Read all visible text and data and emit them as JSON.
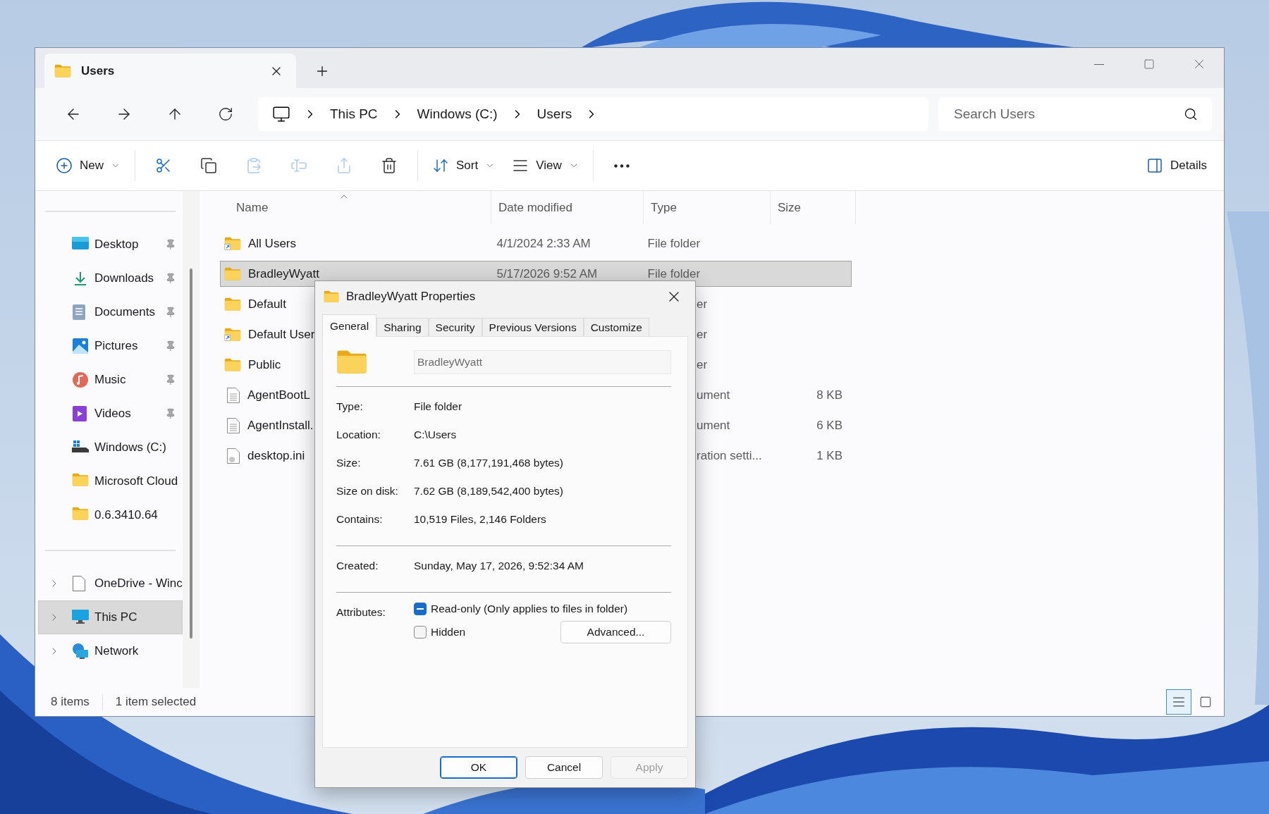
{
  "window": {
    "tab": {
      "title": "Users"
    }
  },
  "address": {
    "crumbs": [
      "This PC",
      "Windows (C:)",
      "Users"
    ],
    "search_placeholder": "Search Users"
  },
  "toolbar": {
    "groups": [
      [
        {
          "kind": "new",
          "label": "New",
          "disabled": false
        }
      ],
      [
        {
          "kind": "cut",
          "disabled": false
        },
        {
          "kind": "copy",
          "disabled": false
        },
        {
          "kind": "paste",
          "disabled": true
        },
        {
          "kind": "rename",
          "disabled": true
        },
        {
          "kind": "share",
          "disabled": true
        },
        {
          "kind": "delete",
          "disabled": false
        }
      ],
      [
        {
          "kind": "sort",
          "label": "Sort",
          "disabled": false
        },
        {
          "kind": "view",
          "label": "View",
          "disabled": false
        }
      ],
      [
        {
          "kind": "more",
          "disabled": false
        }
      ]
    ],
    "details": {
      "label": "Details"
    }
  },
  "nav": {
    "quick_access": [
      {
        "kind": "desktop",
        "label": "Desktop",
        "pinned": true,
        "selected": false
      },
      {
        "kind": "downloads",
        "label": "Downloads",
        "pinned": true,
        "selected": false
      },
      {
        "kind": "documents",
        "label": "Documents",
        "pinned": true,
        "selected": false
      },
      {
        "kind": "pictures",
        "label": "Pictures",
        "pinned": true,
        "selected": false
      },
      {
        "kind": "music",
        "label": "Music",
        "pinned": true,
        "selected": false
      },
      {
        "kind": "videos",
        "label": "Videos",
        "pinned": true,
        "selected": false
      },
      {
        "kind": "drive",
        "label": "Windows (C:)",
        "pinned": false,
        "selected": false
      },
      {
        "kind": "folder",
        "label": "Microsoft Cloud",
        "pinned": false,
        "selected": false
      },
      {
        "kind": "folder",
        "label": "0.6.3410.64",
        "pinned": false,
        "selected": false
      }
    ],
    "locations": [
      {
        "kind": "file",
        "label": "OneDrive - Winc",
        "expanded": false,
        "selected": false
      },
      {
        "kind": "pc",
        "label": "This PC",
        "expanded": false,
        "selected": true
      },
      {
        "kind": "network",
        "label": "Network",
        "expanded": false,
        "selected": false
      }
    ]
  },
  "table": {
    "columns": [
      "Name",
      "Date modified",
      "Type",
      "Size"
    ],
    "rows": [
      {
        "kind": "shortcut-folder",
        "name": "All Users",
        "date": "4/1/2024 2:33 AM",
        "type": "File folder",
        "selected": false
      },
      {
        "kind": "folder",
        "name": "BradleyWyatt",
        "date": "5/17/2026 9:52 AM",
        "type": "File folder",
        "selected": true
      },
      {
        "kind": "folder",
        "name": "Default",
        "type_tail": "er",
        "selected": false
      },
      {
        "kind": "shortcut-folder",
        "name": "Default User",
        "type_tail": "er",
        "selected": false
      },
      {
        "kind": "folder",
        "name": "Public",
        "type_tail": "er",
        "selected": false
      },
      {
        "kind": "document",
        "name": "AgentBootL",
        "type_tail": "ument",
        "size": "8 KB",
        "selected": false
      },
      {
        "kind": "document",
        "name": "AgentInstall.",
        "type_tail": "ument",
        "size": "6 KB",
        "selected": false
      },
      {
        "kind": "settings",
        "name": "desktop.ini",
        "type_tail": "ration setti...",
        "size": "1 KB",
        "selected": false
      }
    ]
  },
  "status_bar": {
    "count": "8 items",
    "selection": "1 item selected",
    "views": [
      {
        "kind": "details",
        "selected": true
      },
      {
        "kind": "tiles",
        "selected": false
      }
    ]
  },
  "dialog": {
    "title": "BradleyWyatt Properties",
    "tabs": [
      {
        "label": "General",
        "selected": true
      },
      {
        "label": "Sharing",
        "selected": false
      },
      {
        "label": "Security",
        "selected": false
      },
      {
        "label": "Previous Versions",
        "selected": false
      },
      {
        "label": "Customize",
        "selected": false
      }
    ],
    "name_field": "BradleyWyatt",
    "groups": [
      [
        {
          "label": "Type:",
          "value": "File folder"
        },
        {
          "label": "Location:",
          "value": "C:\\Users"
        },
        {
          "label": "Size:",
          "value": "7.61 GB (8,177,191,468 bytes)"
        },
        {
          "label": "Size on disk:",
          "value": "7.62 GB (8,189,542,400 bytes)"
        },
        {
          "label": "Contains:",
          "value": "10,519 Files, 2,146 Folders"
        }
      ],
      [
        {
          "label": "Created:",
          "value": "Sunday, May 17, 2026, 9:52:34 AM"
        }
      ]
    ],
    "attributes": {
      "label": "Attributes:",
      "options": [
        {
          "label": "Read-only (Only applies to files in folder)",
          "indeterminate": true
        },
        {
          "label": "Hidden",
          "checked": false,
          "indeterminate": false
        }
      ],
      "advanced": "Advanced..."
    },
    "buttons": [
      {
        "label": "OK",
        "default": true,
        "disabled": false
      },
      {
        "label": "Cancel",
        "default": false,
        "disabled": false
      },
      {
        "label": "Apply",
        "default": false,
        "disabled": true
      }
    ]
  }
}
